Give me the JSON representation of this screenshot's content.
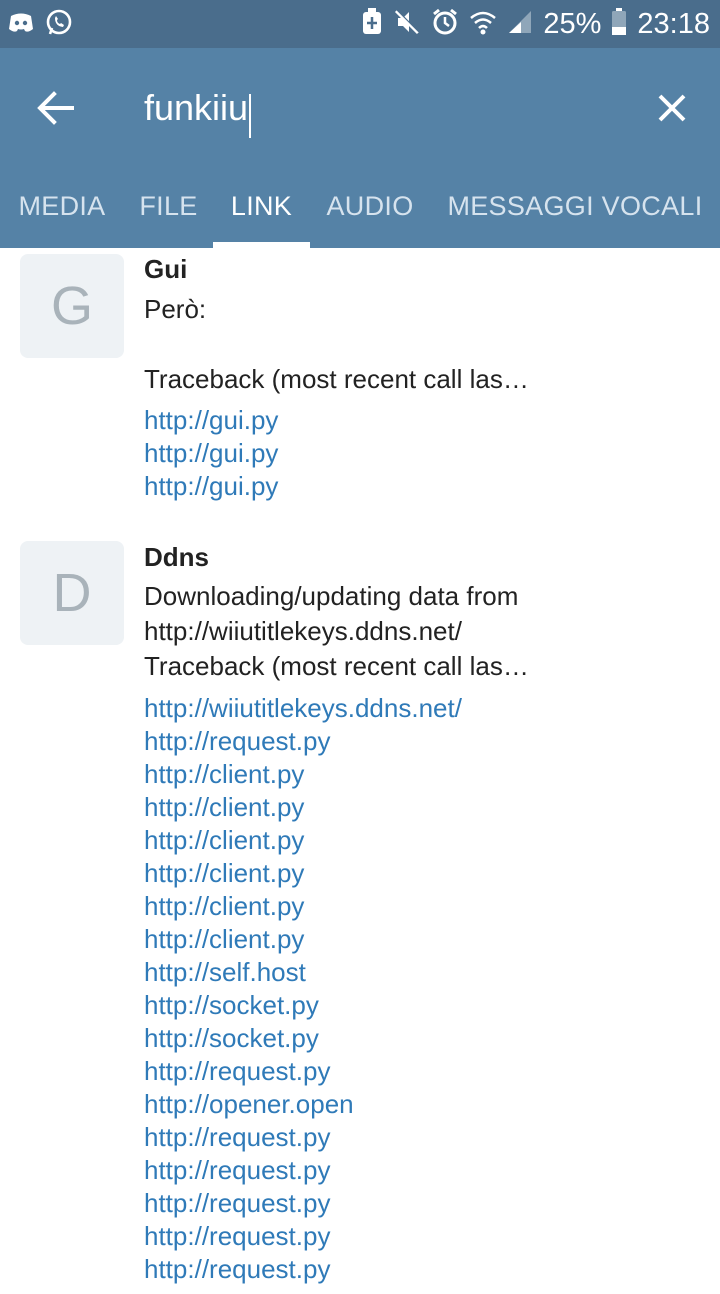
{
  "status_bar": {
    "battery": "25%",
    "time": "23:18",
    "left_icons": [
      "discord-icon",
      "whatsapp-icon"
    ],
    "right_icons": [
      "data-saver-icon",
      "mute-icon",
      "alarm-icon",
      "wifi-icon",
      "signal-icon",
      "battery-icon"
    ]
  },
  "search": {
    "value": "funkiiu"
  },
  "tabs": [
    {
      "label": "MEDIA",
      "active": false
    },
    {
      "label": "FILE",
      "active": false
    },
    {
      "label": "LINK",
      "active": true
    },
    {
      "label": "AUDIO",
      "active": false
    },
    {
      "label": "MESSAGGI VOCALI",
      "active": false
    }
  ],
  "items": [
    {
      "avatar_letter": "G",
      "sender": "Gui",
      "message": "Però:\n\nTraceback (most recent call las…",
      "links": [
        "http://gui.py",
        "http://gui.py",
        "http://gui.py"
      ]
    },
    {
      "avatar_letter": "D",
      "sender": "Ddns",
      "message": "Downloading/updating data from\nhttp://wiiutitlekeys.ddns.net/\nTraceback (most recent call las…",
      "links": [
        "http://wiiutitlekeys.ddns.net/",
        "http://request.py",
        "http://client.py",
        "http://client.py",
        "http://client.py",
        "http://client.py",
        "http://client.py",
        "http://client.py",
        "http://self.host",
        "http://socket.py",
        "http://socket.py",
        "http://request.py",
        "http://opener.open",
        "http://request.py",
        "http://request.py",
        "http://request.py",
        "http://request.py",
        "http://request.py"
      ]
    }
  ],
  "colors": {
    "status_bar": "#4a6d8c",
    "app_bar": "#5582a6",
    "link": "#2f7ab8",
    "avatar_bg": "#eef2f5"
  }
}
